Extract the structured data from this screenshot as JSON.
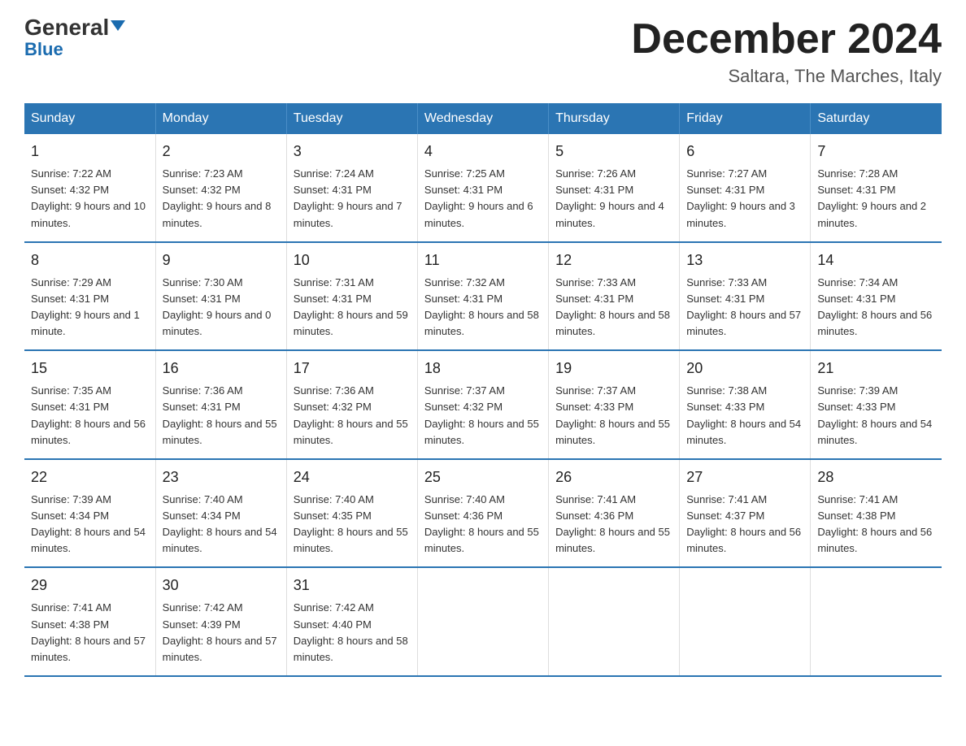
{
  "logo": {
    "name_part1": "General",
    "triangle": "▲",
    "name_part2": "Blue"
  },
  "title": "December 2024",
  "location": "Saltara, The Marches, Italy",
  "days_of_week": [
    "Sunday",
    "Monday",
    "Tuesday",
    "Wednesday",
    "Thursday",
    "Friday",
    "Saturday"
  ],
  "weeks": [
    [
      {
        "day": "1",
        "sunrise": "7:22 AM",
        "sunset": "4:32 PM",
        "daylight": "9 hours and 10 minutes."
      },
      {
        "day": "2",
        "sunrise": "7:23 AM",
        "sunset": "4:32 PM",
        "daylight": "9 hours and 8 minutes."
      },
      {
        "day": "3",
        "sunrise": "7:24 AM",
        "sunset": "4:31 PM",
        "daylight": "9 hours and 7 minutes."
      },
      {
        "day": "4",
        "sunrise": "7:25 AM",
        "sunset": "4:31 PM",
        "daylight": "9 hours and 6 minutes."
      },
      {
        "day": "5",
        "sunrise": "7:26 AM",
        "sunset": "4:31 PM",
        "daylight": "9 hours and 4 minutes."
      },
      {
        "day": "6",
        "sunrise": "7:27 AM",
        "sunset": "4:31 PM",
        "daylight": "9 hours and 3 minutes."
      },
      {
        "day": "7",
        "sunrise": "7:28 AM",
        "sunset": "4:31 PM",
        "daylight": "9 hours and 2 minutes."
      }
    ],
    [
      {
        "day": "8",
        "sunrise": "7:29 AM",
        "sunset": "4:31 PM",
        "daylight": "9 hours and 1 minute."
      },
      {
        "day": "9",
        "sunrise": "7:30 AM",
        "sunset": "4:31 PM",
        "daylight": "9 hours and 0 minutes."
      },
      {
        "day": "10",
        "sunrise": "7:31 AM",
        "sunset": "4:31 PM",
        "daylight": "8 hours and 59 minutes."
      },
      {
        "day": "11",
        "sunrise": "7:32 AM",
        "sunset": "4:31 PM",
        "daylight": "8 hours and 58 minutes."
      },
      {
        "day": "12",
        "sunrise": "7:33 AM",
        "sunset": "4:31 PM",
        "daylight": "8 hours and 58 minutes."
      },
      {
        "day": "13",
        "sunrise": "7:33 AM",
        "sunset": "4:31 PM",
        "daylight": "8 hours and 57 minutes."
      },
      {
        "day": "14",
        "sunrise": "7:34 AM",
        "sunset": "4:31 PM",
        "daylight": "8 hours and 56 minutes."
      }
    ],
    [
      {
        "day": "15",
        "sunrise": "7:35 AM",
        "sunset": "4:31 PM",
        "daylight": "8 hours and 56 minutes."
      },
      {
        "day": "16",
        "sunrise": "7:36 AM",
        "sunset": "4:31 PM",
        "daylight": "8 hours and 55 minutes."
      },
      {
        "day": "17",
        "sunrise": "7:36 AM",
        "sunset": "4:32 PM",
        "daylight": "8 hours and 55 minutes."
      },
      {
        "day": "18",
        "sunrise": "7:37 AM",
        "sunset": "4:32 PM",
        "daylight": "8 hours and 55 minutes."
      },
      {
        "day": "19",
        "sunrise": "7:37 AM",
        "sunset": "4:33 PM",
        "daylight": "8 hours and 55 minutes."
      },
      {
        "day": "20",
        "sunrise": "7:38 AM",
        "sunset": "4:33 PM",
        "daylight": "8 hours and 54 minutes."
      },
      {
        "day": "21",
        "sunrise": "7:39 AM",
        "sunset": "4:33 PM",
        "daylight": "8 hours and 54 minutes."
      }
    ],
    [
      {
        "day": "22",
        "sunrise": "7:39 AM",
        "sunset": "4:34 PM",
        "daylight": "8 hours and 54 minutes."
      },
      {
        "day": "23",
        "sunrise": "7:40 AM",
        "sunset": "4:34 PM",
        "daylight": "8 hours and 54 minutes."
      },
      {
        "day": "24",
        "sunrise": "7:40 AM",
        "sunset": "4:35 PM",
        "daylight": "8 hours and 55 minutes."
      },
      {
        "day": "25",
        "sunrise": "7:40 AM",
        "sunset": "4:36 PM",
        "daylight": "8 hours and 55 minutes."
      },
      {
        "day": "26",
        "sunrise": "7:41 AM",
        "sunset": "4:36 PM",
        "daylight": "8 hours and 55 minutes."
      },
      {
        "day": "27",
        "sunrise": "7:41 AM",
        "sunset": "4:37 PM",
        "daylight": "8 hours and 56 minutes."
      },
      {
        "day": "28",
        "sunrise": "7:41 AM",
        "sunset": "4:38 PM",
        "daylight": "8 hours and 56 minutes."
      }
    ],
    [
      {
        "day": "29",
        "sunrise": "7:41 AM",
        "sunset": "4:38 PM",
        "daylight": "8 hours and 57 minutes."
      },
      {
        "day": "30",
        "sunrise": "7:42 AM",
        "sunset": "4:39 PM",
        "daylight": "8 hours and 57 minutes."
      },
      {
        "day": "31",
        "sunrise": "7:42 AM",
        "sunset": "4:40 PM",
        "daylight": "8 hours and 58 minutes."
      },
      null,
      null,
      null,
      null
    ]
  ],
  "labels": {
    "sunrise": "Sunrise:",
    "sunset": "Sunset:",
    "daylight": "Daylight:"
  }
}
